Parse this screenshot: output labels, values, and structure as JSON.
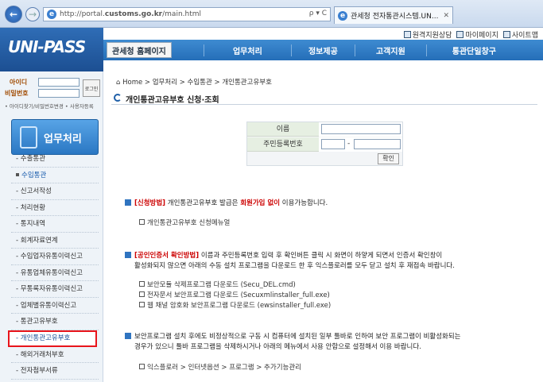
{
  "browser": {
    "url_prefix": "http://portal.",
    "url_bold": "customs.go.kr",
    "url_suffix": "/main.html",
    "addr_tools": "ρ ▾ C",
    "tab_title": "관세청 전자통관시스템.UN..."
  },
  "header": {
    "logo": "UNI-PASS",
    "top_links": [
      "원격지원상담",
      "마이페이지",
      "사이트맵"
    ],
    "nav_home": "관세청 홈페이지",
    "nav": [
      "업무처리",
      "정보제공",
      "고객지원",
      "통관단일창구"
    ]
  },
  "login": {
    "id_label": "아이디",
    "pw_label": "비밀번호",
    "button": "로그인",
    "links": "• 아이디찾기/비밀번호변경  • 사용자등록"
  },
  "sidebar": {
    "title": "업무처리",
    "items": [
      {
        "label": "- 수출통관"
      },
      {
        "label": "수입통관"
      },
      {
        "label": "- 신고서작성"
      },
      {
        "label": "- 처리현황"
      },
      {
        "label": "- 통지내역"
      },
      {
        "label": "- 회계자료연계"
      },
      {
        "label": "- 수입업자유통이력신고"
      },
      {
        "label": "- 유통업체유통이력신고"
      },
      {
        "label": "- 무통록자유통이력신고"
      },
      {
        "label": "- 업체별유통이력신고"
      },
      {
        "label": "- 통관고유부호"
      },
      {
        "label": "- 개인통관고유부호"
      },
      {
        "label": "- 해외거래처부호"
      },
      {
        "label": "- 전자첨부서류"
      }
    ]
  },
  "breadcrumb": "Home > 업무처리 > 수입통관 > 개인통관고유부호",
  "page_title": "개인통관고유부호 신청·조회",
  "form": {
    "name_label": "이름",
    "rrn_label": "주민등록번호",
    "dash": "-",
    "confirm": "확인"
  },
  "sections": {
    "s1_tag": "[신청방법]",
    "s1_text_a": " 개인통관고유부호 발급은 ",
    "s1_highlight": "회원가입 없이",
    "s1_text_b": " 이용가능합니다.",
    "s1_sub": "개인통관고유부호 신청메뉴얼",
    "s2_tag": "[공인인증서 확인방법]",
    "s2_line1": " 이름과 주민등록번호 입력 후 확인버튼 클릭 시 화면이 하얗게 되면서 인증서 확인창이",
    "s2_line2": "활성화되지 않으면 아래의 수동 설치 프로그램을 다운로드 한 후 익스플로러를 모두 닫고 설치 후 재접속 바랍니다.",
    "s2_subs": [
      "보안모듈 삭제프로그램 다운로드 (Secu_DEL.cmd)",
      "전자문서 보안프로그램 다운로드 (Secuxmlinstaller_full.exe)",
      "웹 채널 암호화 보안프로그램 다운로드 (ewsinstaller_full.exe)"
    ],
    "s3_line1": "보안프로그램 설치 후에도 비정상적으로 구동 시 컴퓨터에 설치된 일부 툴바로 인하여 보안 프로그램이 비활성화되는",
    "s3_line2": "경우가 있으니 툴바 프로그램을 삭제하시거나 아래의 메뉴에서 사용 안함으로 설정해서 이용 바랍니다.",
    "s3_sub": "익스플로러 > 인터넷옵션 > 프로그램 > 추가기능관리"
  }
}
